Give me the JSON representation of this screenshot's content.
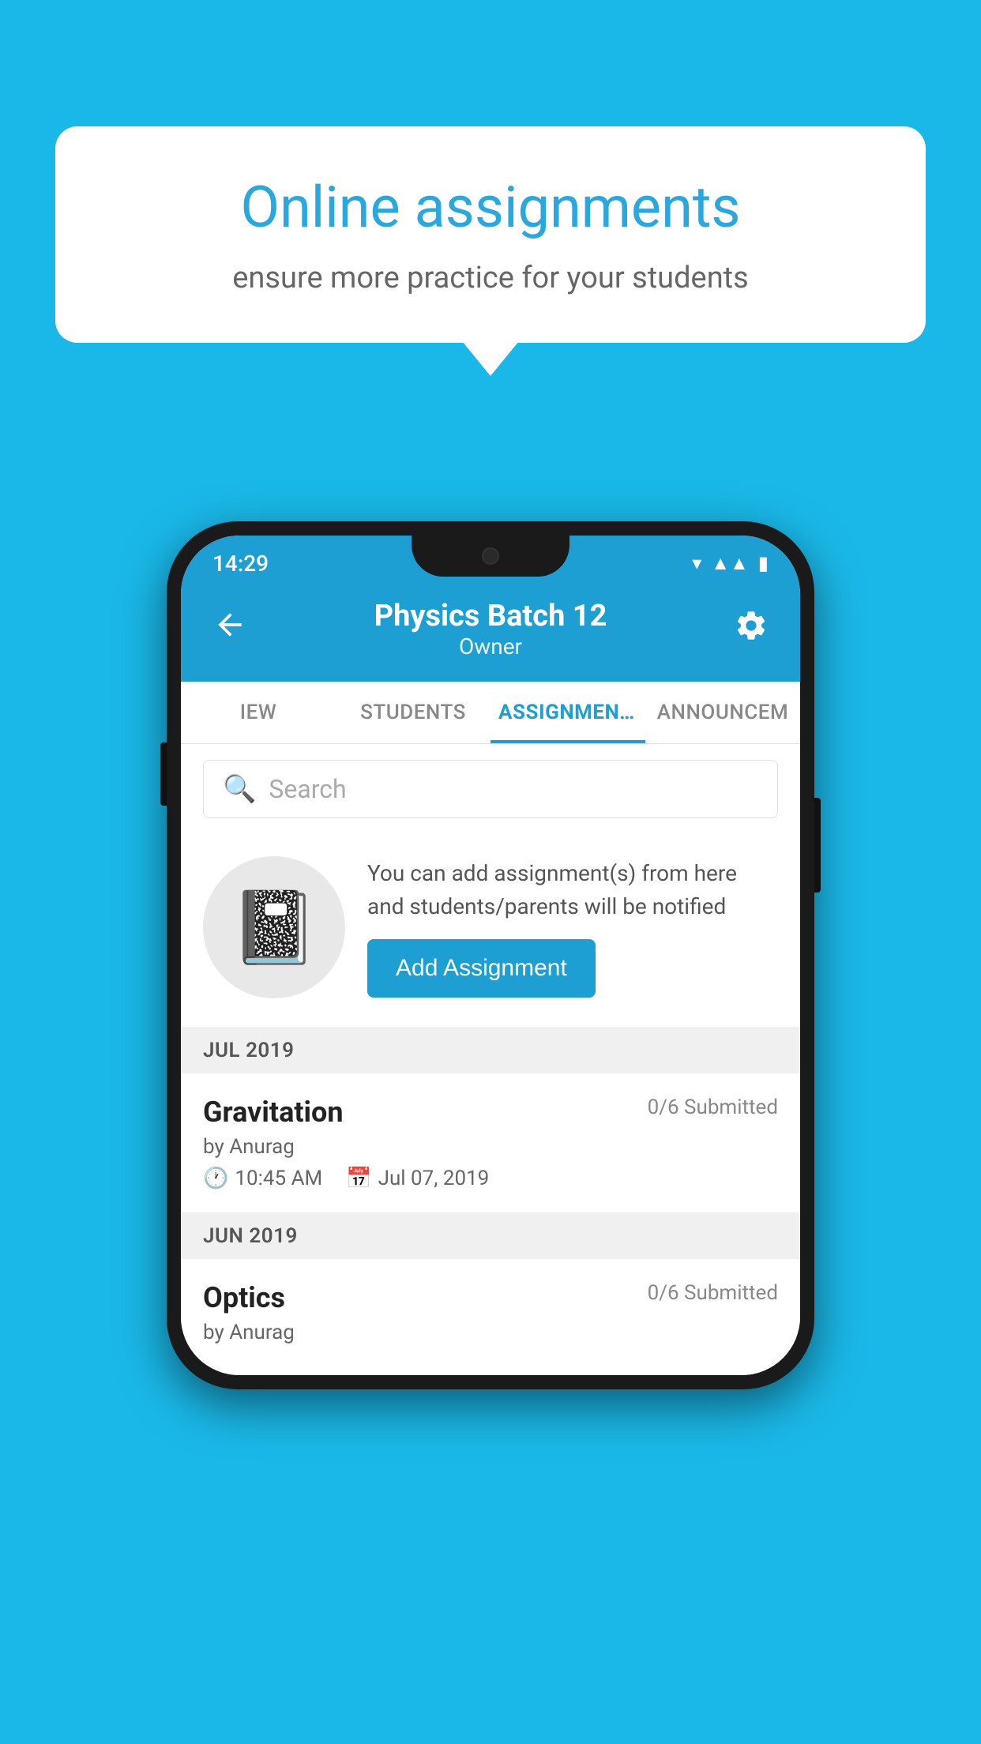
{
  "background_color": "#1ab8e8",
  "speech_bubble": {
    "title": "Online assignments",
    "subtitle": "ensure more practice for your students"
  },
  "phone": {
    "status_bar": {
      "time": "14:29",
      "icons": [
        "wifi",
        "signal",
        "battery"
      ]
    },
    "header": {
      "title": "Physics Batch 12",
      "subtitle": "Owner",
      "back_label": "←",
      "settings_label": "⚙"
    },
    "tabs": [
      {
        "label": "IEW",
        "active": false
      },
      {
        "label": "STUDENTS",
        "active": false
      },
      {
        "label": "ASSIGNMENTS",
        "active": true
      },
      {
        "label": "ANNOUNCEM",
        "active": false
      }
    ],
    "search": {
      "placeholder": "Search"
    },
    "promo_card": {
      "description": "You can add assignment(s) from here and students/parents will be notified",
      "button_label": "Add Assignment"
    },
    "month_sections": [
      {
        "month": "JUL 2019",
        "assignments": [
          {
            "name": "Gravitation",
            "submitted": "0/6 Submitted",
            "author": "by Anurag",
            "time": "10:45 AM",
            "date": "Jul 07, 2019"
          }
        ]
      },
      {
        "month": "JUN 2019",
        "assignments": [
          {
            "name": "Optics",
            "submitted": "0/6 Submitted",
            "author": "by Anurag",
            "time": "",
            "date": ""
          }
        ]
      }
    ]
  }
}
